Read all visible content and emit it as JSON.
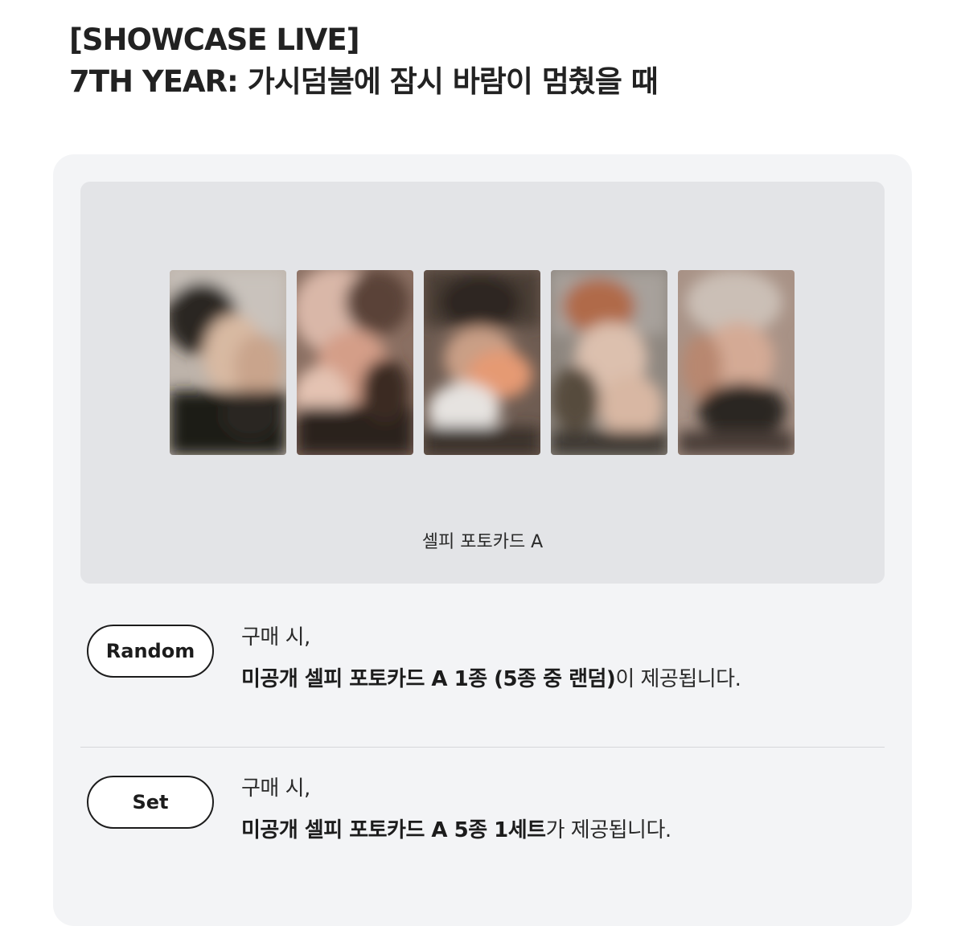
{
  "title": {
    "line1": "[SHOWCASE LIVE]",
    "line2": "7TH YEAR: 가시덤불에 잠시 바람이 멈췄을 때"
  },
  "photocards": {
    "caption": "셀피 포토카드 A",
    "count": 5
  },
  "options": [
    {
      "badge": "Random",
      "line1": "구매 시,",
      "line2_bold": "미공개 셀피 포토카드 A 1종 (5종 중 랜덤)",
      "line2_rest": "이 제공됩니다."
    },
    {
      "badge": "Set",
      "line1": "구매 시,",
      "line2_bold": "미공개 셀피 포토카드 A 5종 1세트",
      "line2_rest": "가 제공됩니다."
    }
  ],
  "colors": {
    "card_bg": "#f3f4f6",
    "panel_bg": "#e3e4e7",
    "badge_border": "#1c1c1c"
  }
}
